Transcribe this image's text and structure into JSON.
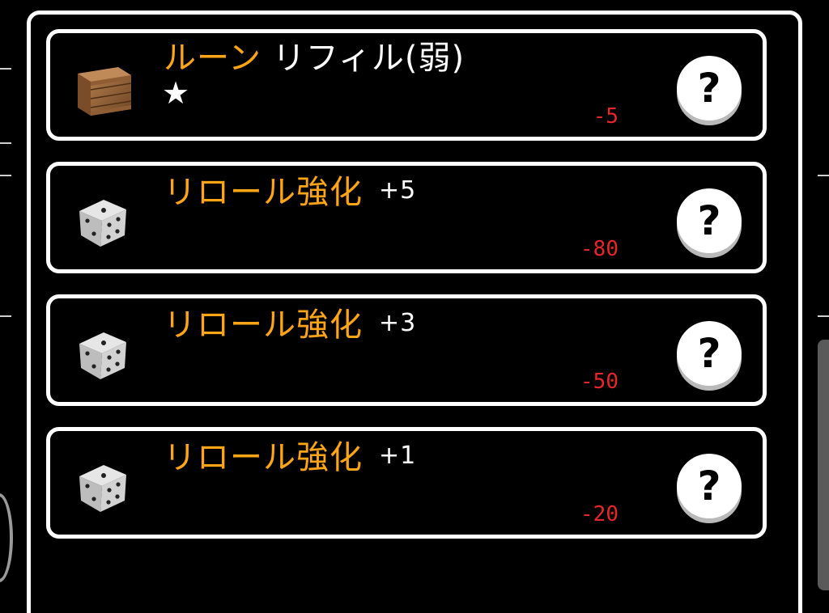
{
  "items": [
    {
      "title_main": "ルーン",
      "title_sub": " リフィル(弱)",
      "level": "",
      "rating": "★",
      "cost": "-5",
      "icon": "crate-icon"
    },
    {
      "title_main": "リロール強化",
      "title_sub": "",
      "level": "+5",
      "rating": "",
      "cost": "-80",
      "icon": "dice-icon"
    },
    {
      "title_main": "リロール強化",
      "title_sub": "",
      "level": "+3",
      "rating": "",
      "cost": "-50",
      "icon": "dice-icon"
    },
    {
      "title_main": "リロール強化",
      "title_sub": "",
      "level": "+1",
      "rating": "",
      "cost": "-20",
      "icon": "dice-icon"
    }
  ],
  "help_label": "?",
  "colors": {
    "title_accent": "#ffa516",
    "cost": "#e8262a",
    "border": "#ffffff",
    "background": "#000000"
  }
}
